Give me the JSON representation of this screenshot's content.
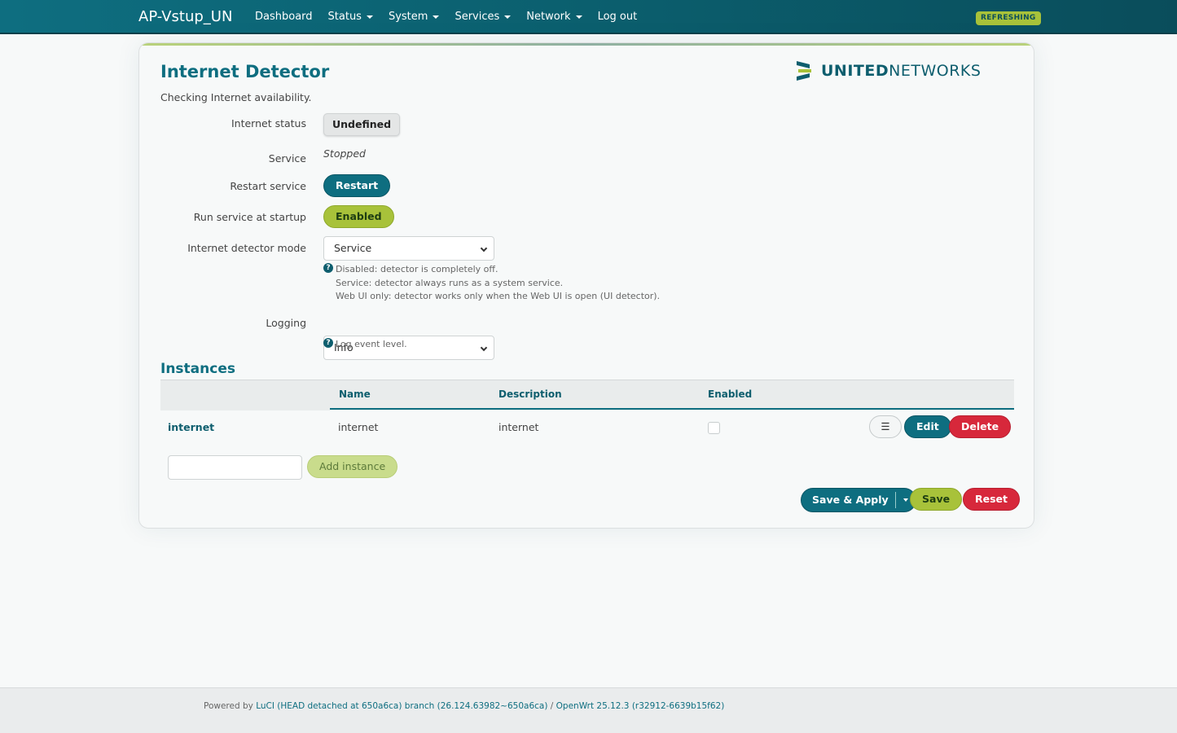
{
  "header": {
    "brand": "AP-Vstup_UN",
    "nav": [
      {
        "label": "Dashboard",
        "dropdown": false
      },
      {
        "label": "Status",
        "dropdown": true
      },
      {
        "label": "System",
        "dropdown": true
      },
      {
        "label": "Services",
        "dropdown": true
      },
      {
        "label": "Network",
        "dropdown": true
      },
      {
        "label": "Log out",
        "dropdown": false
      }
    ],
    "indicator": "REFRESHING"
  },
  "page": {
    "title": "Internet Detector",
    "description": "Checking Internet availability.",
    "logo": {
      "bold": "UNITED",
      "light": "NETWORKS"
    }
  },
  "form": {
    "internet_status": {
      "label": "Internet status",
      "value": "Undefined"
    },
    "service": {
      "label": "Service",
      "value": "Stopped"
    },
    "restart": {
      "label": "Restart service",
      "button": "Restart"
    },
    "startup": {
      "label": "Run service at startup",
      "button": "Enabled"
    },
    "mode": {
      "label": "Internet detector mode",
      "value": "Service",
      "help": [
        "Disabled: detector is completely off.",
        "Service: detector always runs as a system service.",
        "Web UI only: detector works only when the Web UI is open (UI detector)."
      ]
    },
    "logging": {
      "label": "Logging",
      "value": "Info",
      "help": "Log event level."
    }
  },
  "instances": {
    "title": "Instances",
    "columns": [
      "Name",
      "Description",
      "Enabled"
    ],
    "rows": [
      {
        "section": "internet",
        "name": "internet",
        "description": "internet",
        "enabled": false
      }
    ],
    "actions": {
      "menu": "☰",
      "edit": "Edit",
      "delete": "Delete"
    },
    "add_instance": "Add instance"
  },
  "footer_buttons": {
    "save_apply": "Save & Apply",
    "save": "Save",
    "reset": "Reset"
  },
  "footer": {
    "prefix": "Powered by ",
    "luci": "LuCI (HEAD detached at 650a6ca) branch (26.124.63982~650a6ca)",
    "sep": " / ",
    "openwrt": "OpenWrt 25.12.3 (r32912-6639b15f62)"
  },
  "colors": {
    "accent": "#0e6e80",
    "green": "#a8c23a",
    "red": "#d7283b"
  }
}
